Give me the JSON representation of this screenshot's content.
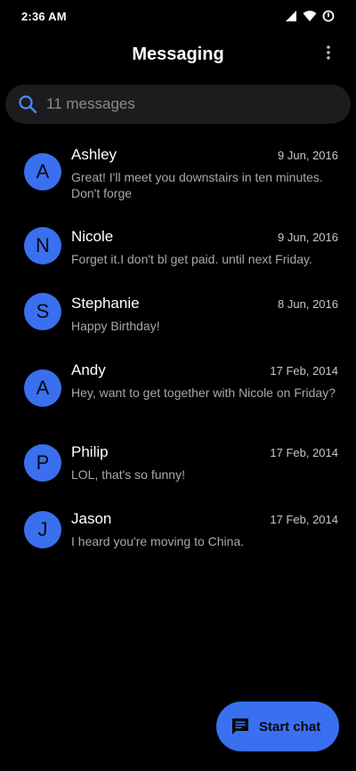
{
  "status_bar": {
    "time": "2:36 AM"
  },
  "app_bar": {
    "title": "Messaging"
  },
  "search": {
    "placeholder": "11 messages"
  },
  "conversations": [
    {
      "initial": "A",
      "name": "Ashley",
      "date": "9 Jun, 2016",
      "snippet": "Great! I'll meet you downstairs in ten minutes. Don't forge"
    },
    {
      "initial": "N",
      "name": "Nicole",
      "date": "9 Jun, 2016",
      "snippet": "Forget it.I don't bl get paid. until next Friday."
    },
    {
      "initial": "S",
      "name": "Stephanie",
      "date": "8 Jun, 2016",
      "snippet": "Happy Birthday!"
    },
    {
      "initial": "A",
      "name": "Andy",
      "date": "17 Feb, 2014",
      "snippet": "Hey, want to get together with Nicole on Friday?"
    },
    {
      "initial": "P",
      "name": "Philip",
      "date": "17 Feb, 2014",
      "snippet": "LOL, that's so funny!"
    },
    {
      "initial": "J",
      "name": "Jason",
      "date": "17 Feb, 2014",
      "snippet": "I heard you're moving to China."
    }
  ],
  "fab": {
    "label": "Start chat"
  },
  "colors": {
    "background": "#000000",
    "accent": "#3a6ff0",
    "search_background": "#1c1c1e"
  },
  "icons": {
    "search": "search-icon",
    "overflow": "more-vert-icon",
    "fab": "chat-icon",
    "signal": "signal-icon",
    "wifi": "wifi-icon",
    "data_saver": "data-saver-icon"
  }
}
